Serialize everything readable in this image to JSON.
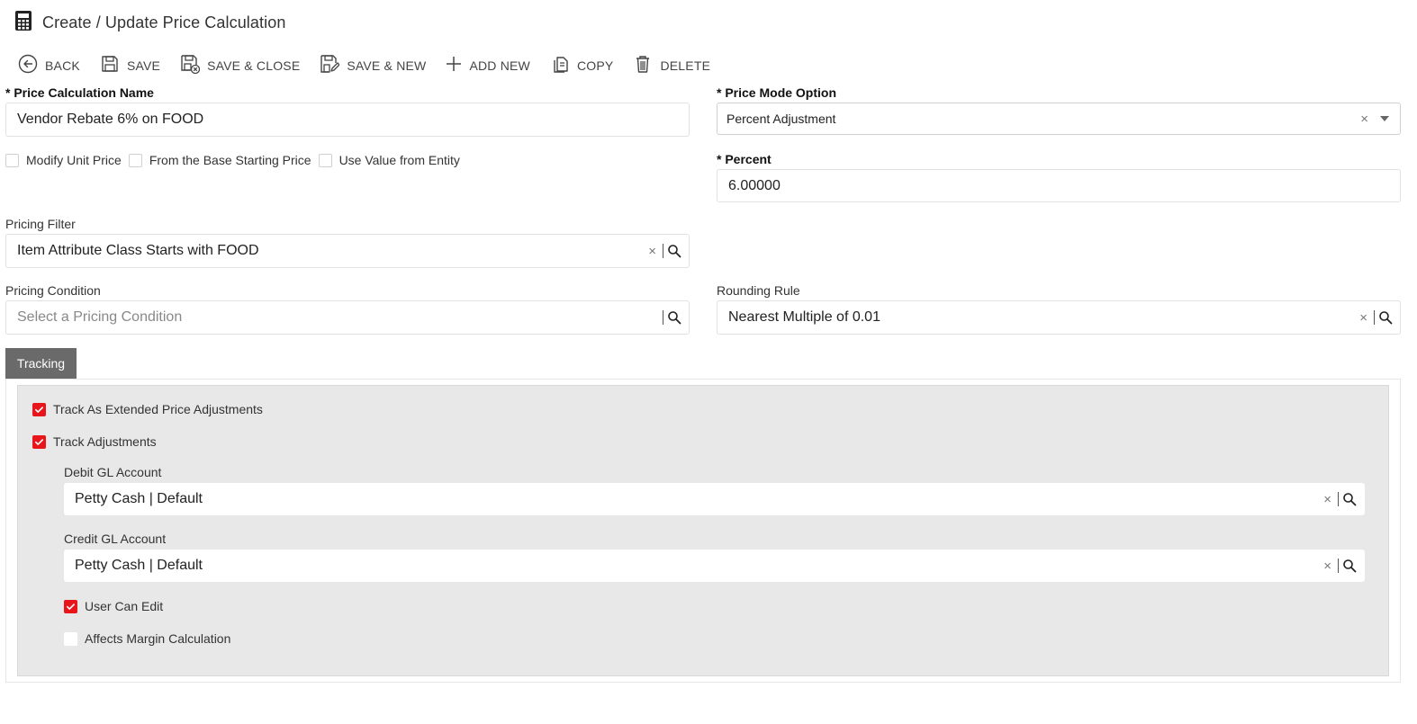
{
  "header": {
    "icon": "calculator-icon",
    "title": "Create / Update Price Calculation"
  },
  "toolbar": {
    "back": "BACK",
    "save": "SAVE",
    "save_close": "SAVE & CLOSE",
    "save_new": "SAVE & NEW",
    "add_new": "ADD NEW",
    "copy": "COPY",
    "delete": "DELETE"
  },
  "form": {
    "price_calc_name": {
      "label": "* Price Calculation Name",
      "value": "Vendor Rebate 6% on FOOD"
    },
    "price_mode": {
      "label": "* Price Mode Option",
      "value": "Percent Adjustment"
    },
    "checkboxes": {
      "modify_unit_price": {
        "label": "Modify Unit Price",
        "checked": false
      },
      "from_base_price": {
        "label": "From the Base Starting Price",
        "checked": false
      },
      "use_value_entity": {
        "label": "Use Value from Entity",
        "checked": false
      }
    },
    "percent": {
      "label": "* Percent",
      "value": "6.00000"
    },
    "pricing_filter": {
      "label": "Pricing Filter",
      "value": "Item Attribute Class Starts with FOOD"
    },
    "pricing_condition": {
      "label": "Pricing Condition",
      "placeholder": "Select a Pricing Condition"
    },
    "rounding_rule": {
      "label": "Rounding Rule",
      "value": "Nearest Multiple of 0.01"
    }
  },
  "tracking": {
    "tab_label": "Tracking",
    "track_extended": {
      "label": "Track As Extended Price Adjustments",
      "checked": true
    },
    "track_adjustments": {
      "label": "Track Adjustments",
      "checked": true
    },
    "debit_gl": {
      "label": "Debit GL Account",
      "value": "Petty Cash | Default"
    },
    "credit_gl": {
      "label": "Credit GL Account",
      "value": "Petty Cash | Default"
    },
    "user_can_edit": {
      "label": "User Can Edit",
      "checked": true
    },
    "affects_margin": {
      "label": "Affects Margin Calculation",
      "checked": false
    }
  },
  "colors": {
    "accent": "#e8161b",
    "tab_bg": "#6a6a6a",
    "panel_bg": "#e8e8e8"
  }
}
